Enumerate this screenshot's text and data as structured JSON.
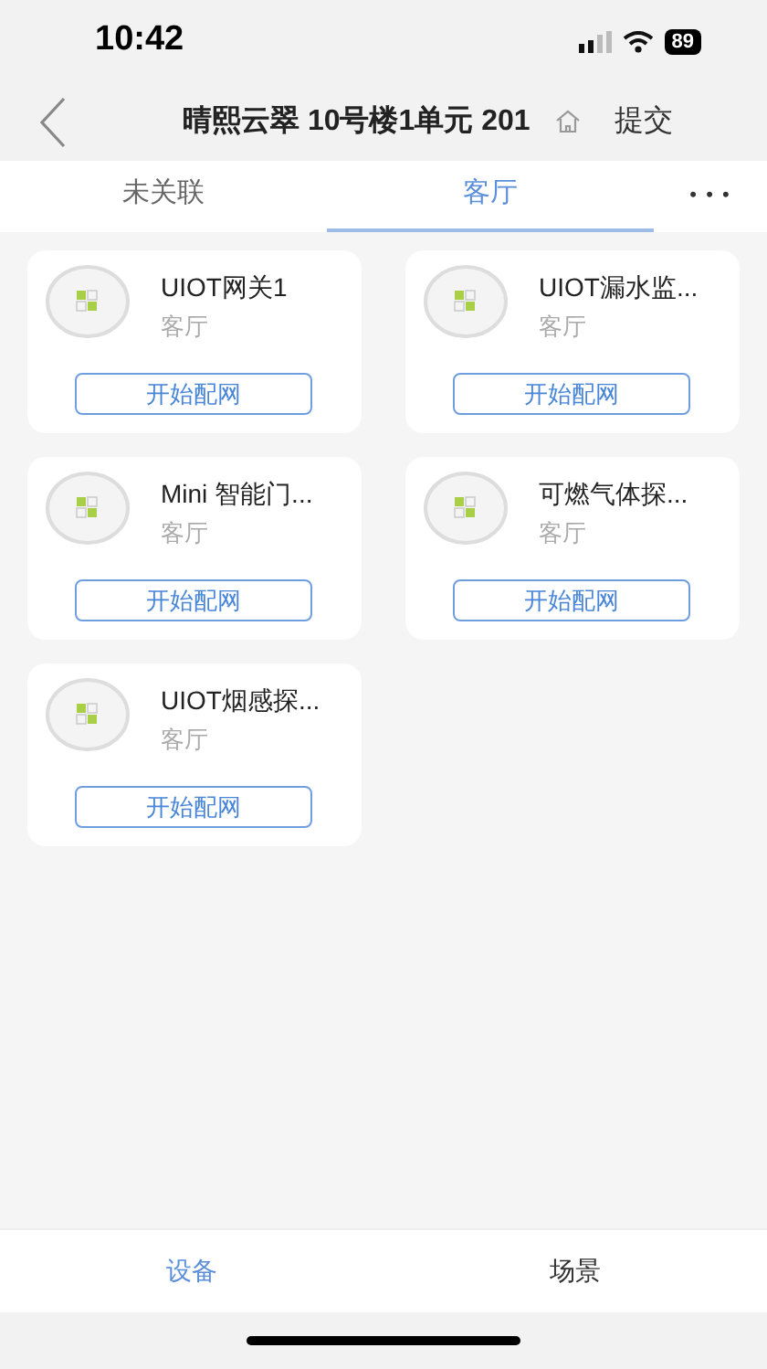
{
  "status_bar": {
    "time": "10:42",
    "battery": "89"
  },
  "nav": {
    "title": "晴熙云翠 10号楼1单元 201",
    "action": "提交"
  },
  "tabs": [
    {
      "label": "未关联",
      "selected": false
    },
    {
      "label": "客厅",
      "selected": true
    }
  ],
  "more": "• • •",
  "devices": [
    {
      "name": "UIOT网关1",
      "room": "客厅",
      "button": "开始配网"
    },
    {
      "name": "UIOT漏水监...",
      "room": "客厅",
      "button": "开始配网"
    },
    {
      "name": "Mini 智能门...",
      "room": "客厅",
      "button": "开始配网"
    },
    {
      "name": "可燃气体探...",
      "room": "客厅",
      "button": "开始配网"
    },
    {
      "name": "UIOT烟感探...",
      "room": "客厅",
      "button": "开始配网"
    }
  ],
  "bottom_tabs": [
    {
      "label": "设备",
      "selected": true
    },
    {
      "label": "场景",
      "selected": false
    }
  ]
}
